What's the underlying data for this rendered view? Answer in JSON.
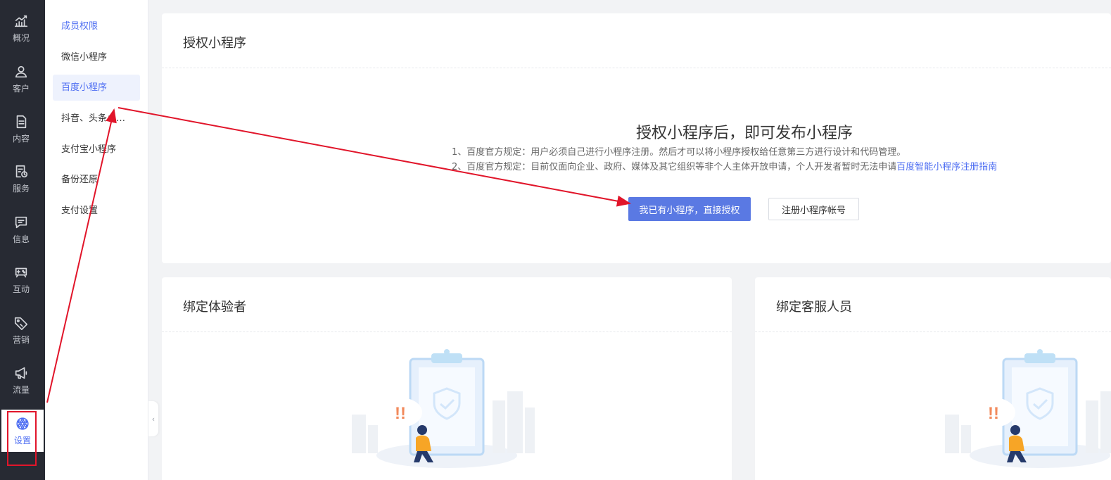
{
  "nav": {
    "items": [
      {
        "label": "概况",
        "icon": "trend-chart-icon"
      },
      {
        "label": "客户",
        "icon": "user-icon"
      },
      {
        "label": "内容",
        "icon": "document-icon"
      },
      {
        "label": "服务",
        "icon": "service-clock-icon"
      },
      {
        "label": "信息",
        "icon": "message-icon"
      },
      {
        "label": "互动",
        "icon": "gamepad-icon"
      },
      {
        "label": "营销",
        "icon": "tag-icon"
      },
      {
        "label": "流量",
        "icon": "megaphone-icon"
      },
      {
        "label": "设置",
        "icon": "gear-icon",
        "active": true
      }
    ]
  },
  "submenu": {
    "items": [
      {
        "label": "成员权限"
      },
      {
        "label": "微信小程序"
      },
      {
        "label": "百度小程序",
        "active": true
      },
      {
        "label": "抖音、头条小程序"
      },
      {
        "label": "支付宝小程序"
      },
      {
        "label": "备份还原"
      },
      {
        "label": "支付设置"
      }
    ]
  },
  "auth_card": {
    "title": "授权小程序",
    "heading": "授权小程序后，即可发布小程序",
    "rule1": "1、百度官方规定：用户必须自己进行小程序注册。然后才可以将小程序授权给任意第三方进行设计和代码管理。",
    "rule2_text": "2、百度官方规定：目前仅面向企业、政府、媒体及其它组织等非个人主体开放申请，个人开发者暂时无法申请",
    "rule2_link": "百度智能小程序注册指南",
    "primary_button": "我已有小程序，直接授权",
    "secondary_button": "注册小程序帐号"
  },
  "tester_card": {
    "title": "绑定体验者"
  },
  "service_card": {
    "title": "绑定客服人员"
  },
  "illustration": {
    "alert_text": "!!"
  },
  "colors": {
    "accent": "#4e6ef2",
    "button": "#5a79e3",
    "annotation": "#e1152a",
    "nav_bg": "#272a33"
  }
}
